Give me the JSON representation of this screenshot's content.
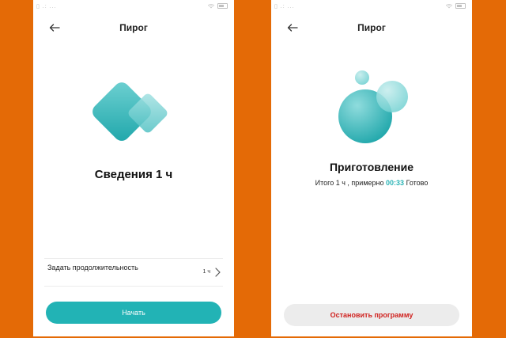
{
  "left_screen": {
    "title": "Пирог",
    "status": "Сведения 1 ч",
    "duration_label": "Задать продолжительность",
    "duration_value": "1 ч",
    "start_button": "Начать"
  },
  "right_screen": {
    "title": "Пирог",
    "status": "Приготовление",
    "summary_prefix": "Итого 1 ч  , примерно",
    "summary_time": "00:33",
    "summary_suffix": "Готово",
    "stop_button": "Остановить программу"
  },
  "colors": {
    "background": "#e46a06",
    "accent": "#22b3b5",
    "stop_text": "#d0221f"
  },
  "icons": [
    "back-arrow-icon",
    "chevron-right-icon",
    "wifi-icon",
    "battery-icon"
  ]
}
